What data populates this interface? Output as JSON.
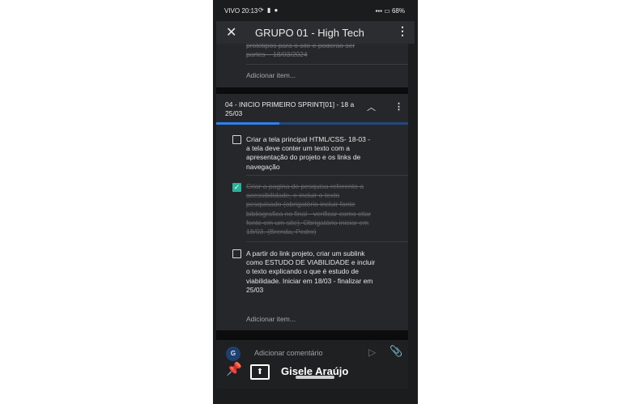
{
  "status_bar": {
    "time": "VIVO 20:13",
    "battery": "68%"
  },
  "app_bar": {
    "title": "GRUPO 01 - High Tech"
  },
  "previous_card": {
    "faded_text": "protótipos para o site e poderão ser partes – 18/03/2024",
    "add_item_label": "Adicionar item..."
  },
  "section": {
    "title": "04 - INICIO PRIMEIRO SPRINT[01] - 18 a 25/03",
    "progress_percent": 33,
    "tasks": [
      {
        "checked": false,
        "text": "Criar a tela principal HTML/CSS- 18-03 - a tela deve conter um texto com a apresentação do projeto e os links de navegação"
      },
      {
        "checked": true,
        "text": "Criar a pagina de pesquisa referente a acessibilidade, e incluir o texto pesquisado (obrigatório incluir fonte bibliografica no final - verificar como citar fonte em um site). Obrigatório iniciar em 18/03. (Brenda, Pedro)"
      },
      {
        "checked": false,
        "text": "A partir do link projeto, criar um sublink como ESTUDO DE VIABILIDADE e incluir o texto explicando o que é estudo de viabilidade. Iniciar em 18/03 - finalizar em 25/03"
      }
    ],
    "add_item_label": "Adicionar item..."
  },
  "comment_bar": {
    "avatar_initial": "G",
    "placeholder": "Adicionar comentário"
  },
  "overlay": {
    "user_name": "Gisele Araújo"
  },
  "icons": {
    "close": "close-icon",
    "menu": "more-vert-icon",
    "collapse": "chevron-up-icon",
    "send": "send-icon",
    "attach": "paperclip-icon",
    "pin": "pin-icon",
    "share": "screen-share-icon"
  },
  "colors": {
    "progress": "#2f7ff1",
    "checkbox_checked": "#2bb39a",
    "background": "#26272a"
  }
}
